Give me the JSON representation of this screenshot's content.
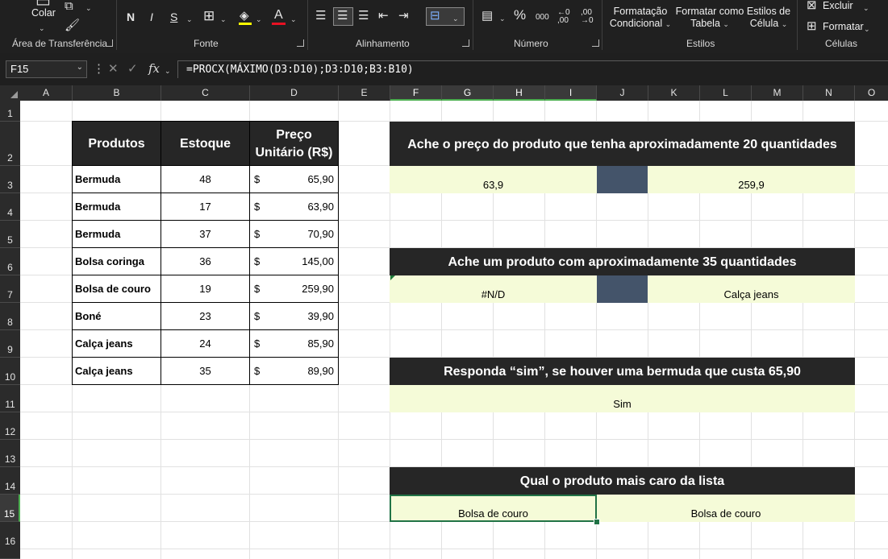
{
  "ribbon": {
    "clipboard": {
      "paste_label": "Colar",
      "group_label": "Área de Transferência"
    },
    "font": {
      "bold": "N",
      "italic": "I",
      "underline": "S",
      "group_label": "Fonte"
    },
    "alignment": {
      "group_label": "Alinhamento"
    },
    "number": {
      "percent": "%",
      "thousands": "000",
      "group_label": "Número"
    },
    "styles": {
      "conditional_line1": "Formatação",
      "conditional_line2": "Condicional",
      "table_line1": "Formatar como",
      "table_line2": "Tabela",
      "cell_line1": "Estilos de",
      "cell_line2": "Célula",
      "group_label": "Estilos"
    },
    "cells": {
      "delete_label": "Excluir",
      "format_label": "Formatar",
      "group_label": "Células"
    }
  },
  "formula_bar": {
    "name_box": "F15",
    "fx": "fx",
    "formula": "=PROCX(MÁXIMO(D3:D10);D3:D10;B3:B10)"
  },
  "columns": [
    "A",
    "B",
    "C",
    "D",
    "E",
    "F",
    "G",
    "H",
    "I",
    "J",
    "K",
    "L",
    "M",
    "N",
    "O"
  ],
  "rows": [
    "1",
    "2",
    "3",
    "4",
    "5",
    "6",
    "7",
    "8",
    "9",
    "10",
    "11",
    "12",
    "13",
    "14",
    "15",
    "16"
  ],
  "table": {
    "headers": {
      "produtos": "Produtos",
      "estoque": "Estoque",
      "preco_line1": "Preço",
      "preco_line2": "Unitário (R$)"
    },
    "currency": "$",
    "rows": [
      {
        "produto": "Bermuda",
        "estoque": "48",
        "preco": "65,90"
      },
      {
        "produto": "Bermuda",
        "estoque": "17",
        "preco": "63,90"
      },
      {
        "produto": "Bermuda",
        "estoque": "37",
        "preco": "70,90"
      },
      {
        "produto": "Bolsa coringa",
        "estoque": "36",
        "preco": "145,00"
      },
      {
        "produto": "Bolsa de couro",
        "estoque": "19",
        "preco": "259,90"
      },
      {
        "produto": "Boné",
        "estoque": "23",
        "preco": "39,90"
      },
      {
        "produto": "Calça jeans",
        "estoque": "24",
        "preco": "85,90"
      },
      {
        "produto": "Calça jeans",
        "estoque": "35",
        "preco": "89,90"
      }
    ]
  },
  "questions": {
    "q1": {
      "title": "Ache o preço do produto que tenha aproximadamente 20 quantidades",
      "left": "63,9",
      "right": "259,9"
    },
    "q2": {
      "title": "Ache um produto com aproximadamente 35 quantidades",
      "left": "#N/D",
      "right": "Calça jeans"
    },
    "q3": {
      "title": "Responda “sim”, se houver uma bermuda que custa 65,90",
      "answer": "Sim"
    },
    "q4": {
      "title": "Qual o produto mais caro da lista",
      "left": "Bolsa de couro",
      "right": "Bolsa de couro"
    }
  },
  "colors": {
    "header_bg": "#262626",
    "answer_bg": "#f5fbd8",
    "divider_bg": "#44546a",
    "selection": "#217346"
  }
}
